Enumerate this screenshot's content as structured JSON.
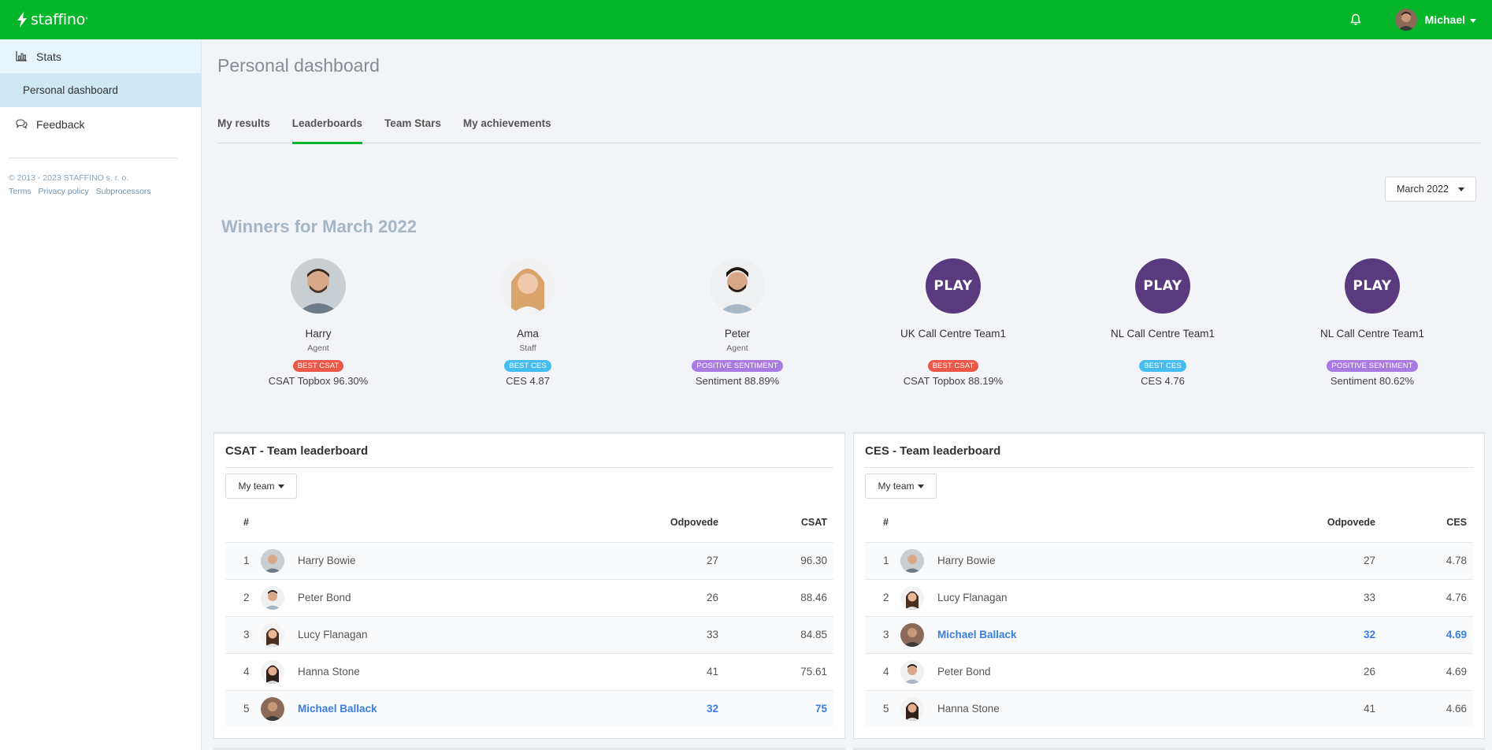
{
  "app": {
    "logo_text": "staffino",
    "user_name": "Michael"
  },
  "sidebar": {
    "items": [
      {
        "label": "Stats",
        "icon": "bar-chart-icon"
      },
      {
        "label": "Personal dashboard"
      },
      {
        "label": "Feedback",
        "icon": "chat-bubbles-icon"
      }
    ],
    "copyright": "© 2013 - 2023 STAFFINO s. r. o.",
    "links": [
      "Terms",
      "Privacy policy",
      "Subprocessors"
    ]
  },
  "page": {
    "title": "Personal dashboard",
    "tabs": [
      "My results",
      "Leaderboards",
      "Team Stars",
      "My achievements"
    ],
    "active_tab": "Leaderboards",
    "month_select": "March 2022",
    "winners_title": "Winners for March 2022"
  },
  "winners": [
    {
      "name": "Harry",
      "role": "Agent",
      "badge": "BEST CSAT",
      "badge_color": "#ec5848",
      "value": "CSAT Topbox 96.30%"
    },
    {
      "name": "Ama",
      "role": "Staff",
      "badge": "BEST CES",
      "badge_color": "#46bdf1",
      "value": "CES 4.87"
    },
    {
      "name": "Peter",
      "role": "Agent",
      "badge": "POSITIVE SENTIMENT",
      "badge_color": "#a87ae2",
      "value": "Sentiment 88.89%"
    },
    {
      "name": "UK Call Centre Team1",
      "role": "",
      "logo": "PLAY",
      "badge": "BEST CSAT",
      "badge_color": "#ec5848",
      "value": "CSAT Topbox 88.19%"
    },
    {
      "name": "NL Call Centre Team1",
      "role": "",
      "logo": "PLAY",
      "badge": "BEST CES",
      "badge_color": "#46bdf1",
      "value": "CES 4.76"
    },
    {
      "name": "NL Call Centre Team1",
      "role": "",
      "logo": "PLAY",
      "badge": "POSITIVE SENTIMENT",
      "badge_color": "#a87ae2",
      "value": "Sentiment 80.62%"
    }
  ],
  "csat_board": {
    "title": "CSAT - Team leaderboard",
    "filter": "My team",
    "columns": [
      "#",
      "Odpovede",
      "CSAT"
    ],
    "rows": [
      {
        "rank": "1",
        "name": "Harry Bowie",
        "responses": "27",
        "score": "96.30",
        "me": false
      },
      {
        "rank": "2",
        "name": "Peter Bond",
        "responses": "26",
        "score": "88.46",
        "me": false
      },
      {
        "rank": "3",
        "name": "Lucy Flanagan",
        "responses": "33",
        "score": "84.85",
        "me": false
      },
      {
        "rank": "4",
        "name": "Hanna Stone",
        "responses": "41",
        "score": "75.61",
        "me": false
      },
      {
        "rank": "5",
        "name": "Michael Ballack",
        "responses": "32",
        "score": "75",
        "me": true
      }
    ]
  },
  "ces_board": {
    "title": "CES - Team leaderboard",
    "filter": "My team",
    "columns": [
      "#",
      "Odpovede",
      "CES"
    ],
    "rows": [
      {
        "rank": "1",
        "name": "Harry Bowie",
        "responses": "27",
        "score": "4.78",
        "me": false
      },
      {
        "rank": "2",
        "name": "Lucy Flanagan",
        "responses": "33",
        "score": "4.76",
        "me": false
      },
      {
        "rank": "3",
        "name": "Michael Ballack",
        "responses": "32",
        "score": "4.69",
        "me": true
      },
      {
        "rank": "4",
        "name": "Peter Bond",
        "responses": "26",
        "score": "4.69",
        "me": false
      },
      {
        "rank": "5",
        "name": "Hanna Stone",
        "responses": "41",
        "score": "4.66",
        "me": false
      }
    ]
  },
  "colors": {
    "brand": "#05b52a",
    "highlight": "#3b7de0"
  }
}
